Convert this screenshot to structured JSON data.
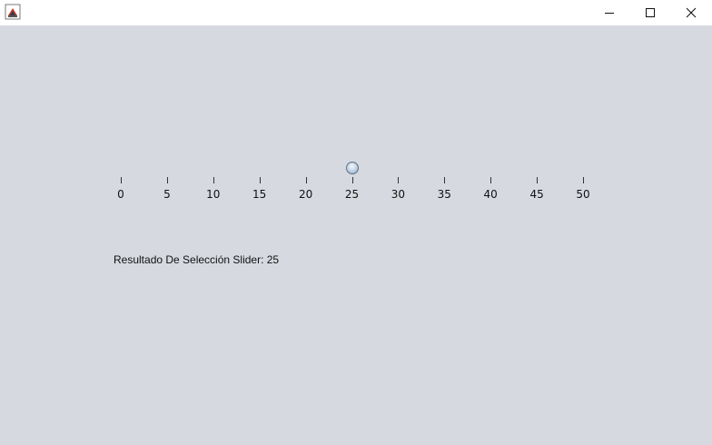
{
  "window": {
    "icon": "java-app-icon",
    "controls": {
      "minimize_icon": "minimize-icon",
      "maximize_icon": "maximize-icon",
      "close_icon": "close-icon"
    }
  },
  "slider": {
    "min": 0,
    "max": 50,
    "value": 25,
    "tick_labels": [
      "0",
      "5",
      "10",
      "15",
      "20",
      "25",
      "30",
      "35",
      "40",
      "45",
      "50"
    ]
  },
  "result": {
    "text": "Resultado De Selección Slider: 25"
  },
  "colors": {
    "content_background": "#d6d9e0",
    "titlebar_background": "#ffffff",
    "thumb_border": "#5b6f86"
  }
}
